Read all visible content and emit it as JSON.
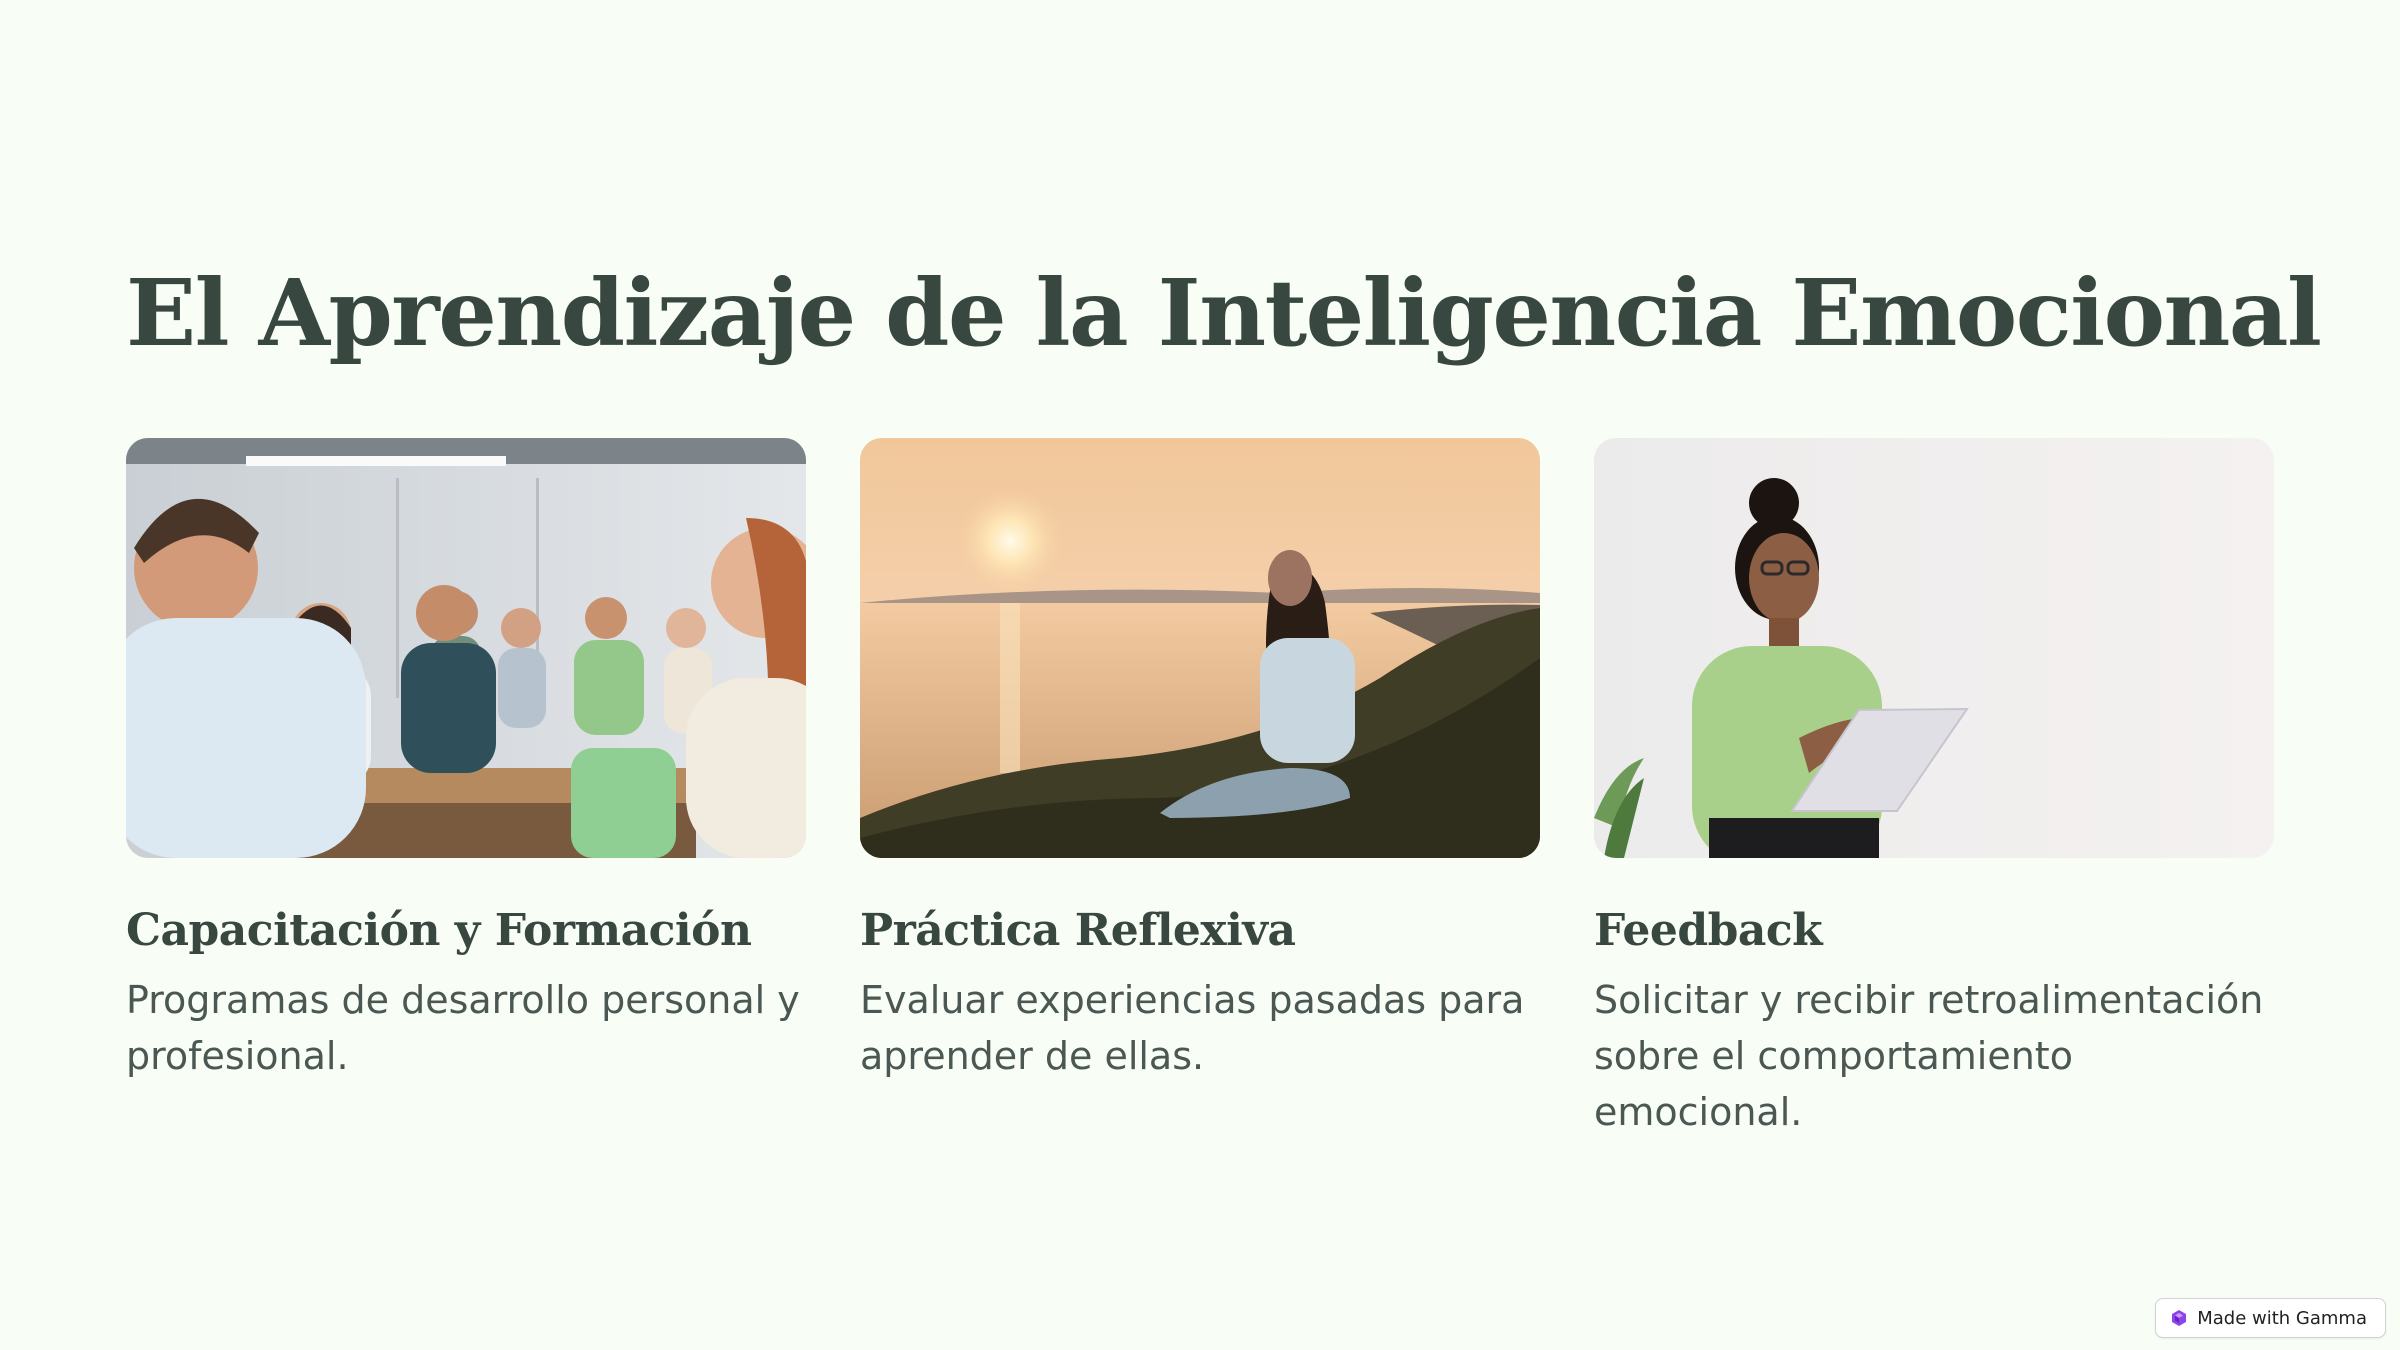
{
  "slide": {
    "title": "El Aprendizaje de la Inteligencia Emocional",
    "cards": [
      {
        "title": "Capacitación y Formación",
        "text": "Programas de desarrollo personal y profesional.",
        "image": "training-classroom-photo"
      },
      {
        "title": "Práctica Reflexiva",
        "text": "Evaluar experiencias pasadas para aprender de ellas.",
        "image": "sunset-reflection-photo"
      },
      {
        "title": "Feedback",
        "text": "Solicitar y recibir retroalimentación sobre el comportamiento emocional.",
        "image": "feedback-presenter-photo"
      }
    ]
  },
  "badge": {
    "label": "Made with Gamma",
    "icon": "gamma-logo-icon"
  },
  "colors": {
    "background": "#f8fdf6",
    "heading": "#384740",
    "body_text": "#4b5752",
    "accent": "#8e44ec"
  }
}
